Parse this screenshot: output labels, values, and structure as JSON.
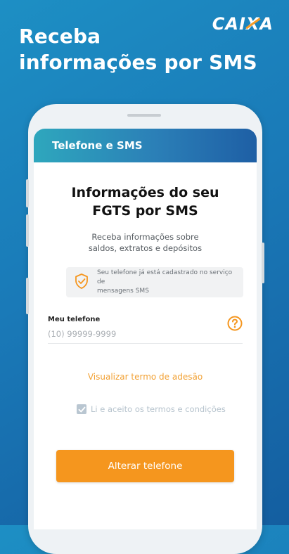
{
  "promo": {
    "headline_line1": "Receba",
    "headline_line2": "informações por SMS"
  },
  "brand": {
    "logo_text_left": "CAI",
    "logo_text_x": "X",
    "logo_text_right": "A"
  },
  "appbar": {
    "title": "Telefone e SMS"
  },
  "main": {
    "title_line1": "Informações do seu",
    "title_line2": "FGTS por SMS",
    "subtitle_line1": "Receba informações sobre",
    "subtitle_line2": "saldos, extratos e depósitos",
    "notice_line1": "Seu telefone já está cadastrado no serviço de",
    "notice_line2": "mensagens SMS",
    "notice_icon": "shield-check-icon"
  },
  "phone_field": {
    "label": "Meu telefone",
    "value": "",
    "placeholder": "(10) 99999-9999",
    "help_icon": "help-icon"
  },
  "terms": {
    "link_label": "Visualizar termo de adesão",
    "checkbox_label": "Li e aceito os termos e condições",
    "checked": true
  },
  "actions": {
    "primary_label": "Alterar telefone"
  },
  "colors": {
    "accent_orange": "#f5961e",
    "appbar_start": "#2ea7bd",
    "appbar_end": "#1e5fa5",
    "background_blue": "#1a7ab8"
  }
}
